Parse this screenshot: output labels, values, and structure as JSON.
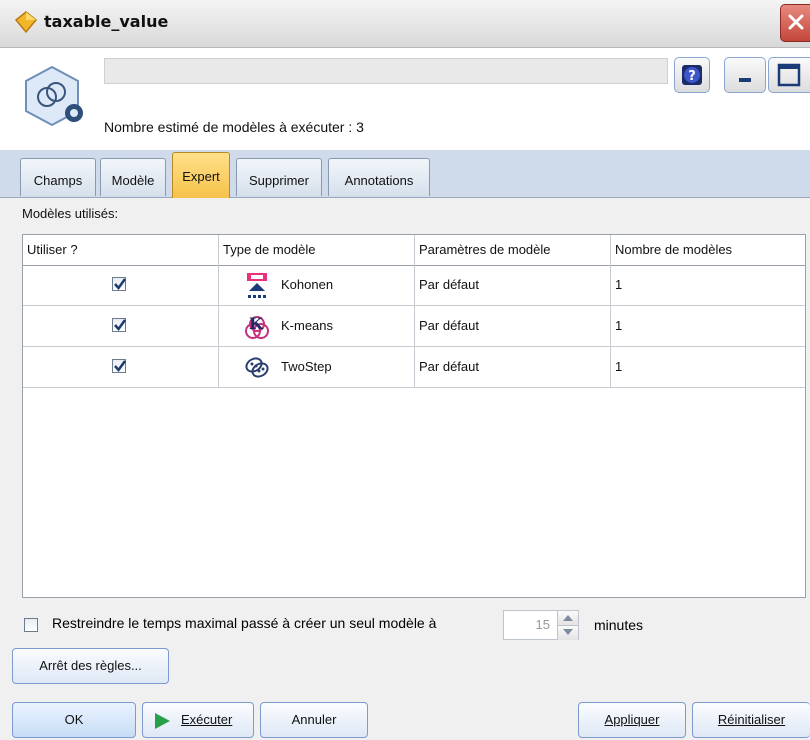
{
  "window": {
    "title": "taxable_value",
    "close_icon": "close-icon"
  },
  "header": {
    "node_name_value": "",
    "estimate_text": "Nombre estimé de modèles à exécuter : 3",
    "help_icon": "help-icon",
    "minimize_icon": "minimize-icon",
    "maximize_icon": "maximize-icon"
  },
  "tabs": [
    {
      "label": "Champs",
      "active": false
    },
    {
      "label": "Modèle",
      "active": false
    },
    {
      "label": "Expert",
      "active": true
    },
    {
      "label": "Supprimer",
      "active": false
    },
    {
      "label": "Annotations",
      "active": false
    }
  ],
  "models_section": {
    "label": "Modèles utilisés:",
    "columns": [
      "Utiliser ?",
      "Type de modèle",
      "Paramètres de modèle",
      "Nombre de modèles"
    ],
    "rows": [
      {
        "use": true,
        "model": "Kohonen",
        "icon": "kohonen-icon",
        "params": "Par défaut",
        "count": "1"
      },
      {
        "use": true,
        "model": "K-means",
        "icon": "kmeans-icon",
        "params": "Par défaut",
        "count": "1"
      },
      {
        "use": true,
        "model": "TwoStep",
        "icon": "twostep-icon",
        "params": "Par défaut",
        "count": "1"
      }
    ]
  },
  "restrict": {
    "checked": false,
    "label": "Restreindre le temps maximal passé à créer un seul modèle à",
    "value": "15",
    "unit": "minutes"
  },
  "buttons": {
    "rules": "Arrêt des règles...",
    "ok": "OK",
    "run": "Exécuter",
    "cancel": "Annuler",
    "apply": "Appliquer",
    "reset": "Réinitialiser"
  },
  "colors": {
    "active_tab": "#f6c24a",
    "tab_strip": "#cfdbea",
    "button_border": "#7c9ad0"
  }
}
